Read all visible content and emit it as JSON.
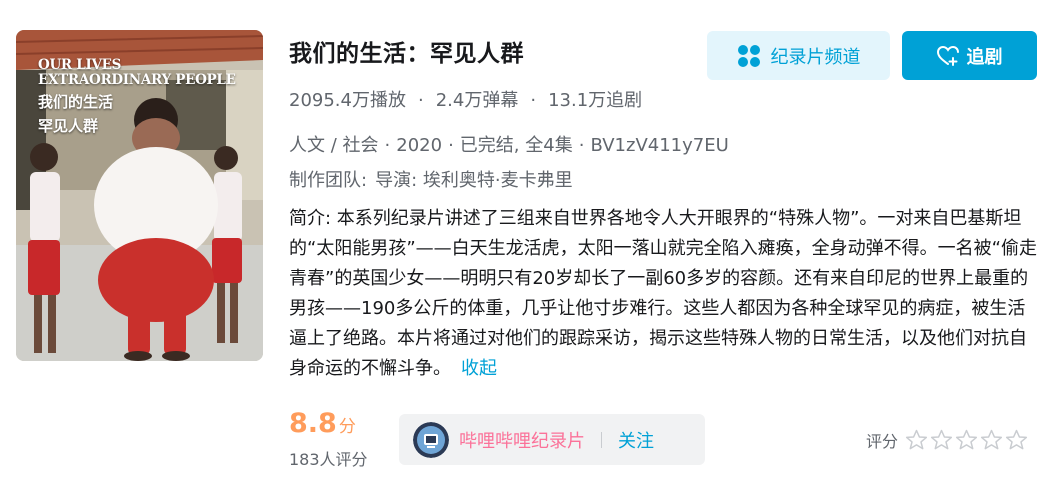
{
  "poster": {
    "caption_en_line1": "OUR LIVES",
    "caption_en_line2": "EXTRAORDINARY PEOPLE",
    "caption_zh_line1": "我们的生活",
    "caption_zh_line2": "罕见人群"
  },
  "title": "我们的生活：罕见人群",
  "stats": {
    "plays": "2095.4万播放",
    "danmaku": "2.4万弹幕",
    "follows": "13.1万追剧",
    "separator": "·"
  },
  "meta": {
    "genre": "人文 / 社会",
    "year": "2020",
    "status": "已完结, 全4集",
    "bvid": "BV1zV411y7EU",
    "separator": "·"
  },
  "staff": {
    "label": "制作团队:",
    "value": "导演: 埃利奥特·麦卡弗里"
  },
  "description": {
    "text": "简介: 本系列纪录片讲述了三组来自世界各地令人大开眼界的“特殊人物”。一对来自巴基斯坦的“太阳能男孩”——白天生龙活虎，太阳一落山就完全陷入瘫痪，全身动弹不得。一名被“偷走青春”的英国少女——明明只有20岁却长了一副60多岁的容颜。还有来自印尼的世界上最重的男孩——190多公斤的体重，几乎让他寸步难行。这些人都因为各种全球罕见的病症，被生活逼上了绝路。本片将通过对他们的跟踪采访，揭示这些特殊人物的日常生活，以及他们对抗自身命运的不懈斗争。",
    "collapse_label": "收起"
  },
  "buttons": {
    "channel_label": "纪录片频道",
    "follow_label": "追剧"
  },
  "score": {
    "value": "8.8",
    "unit": "分",
    "raters": "183人评分"
  },
  "uploader": {
    "name": "哔哩哔哩纪录片",
    "follow_label": "关注"
  },
  "rating": {
    "label": "评分",
    "stars": 5,
    "selected": 0
  },
  "colors": {
    "accent": "#00a1d6",
    "score": "#ff9c5b",
    "uploader_name": "#fb7299",
    "text_secondary": "#61666d"
  }
}
